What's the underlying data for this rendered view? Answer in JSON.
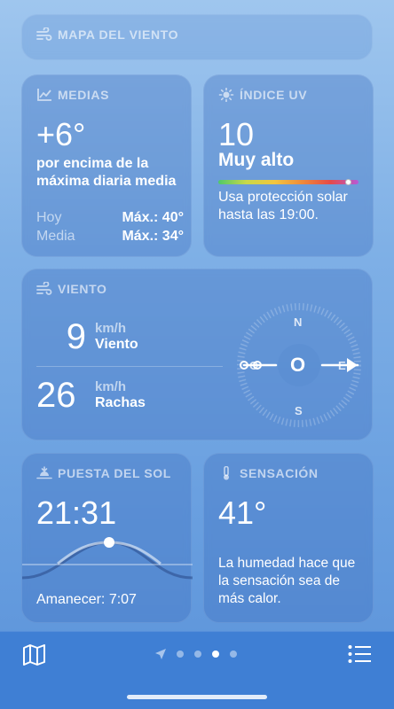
{
  "map_card": {
    "title": "MAPA DEL VIENTO",
    "icon": "wind-icon"
  },
  "medias": {
    "title": "MEDIAS",
    "icon": "chart-icon",
    "value": "+6°",
    "description": "por encima de la máxima diaria media",
    "rows": [
      {
        "label": "Hoy",
        "value": "Máx.: 40°"
      },
      {
        "label": "Media",
        "value": "Máx.: 34°"
      }
    ]
  },
  "uv": {
    "title": "ÍNDICE UV",
    "icon": "sun-icon",
    "value": "10",
    "level": "Muy alto",
    "level_fraction": 0.93,
    "advice": "Usa protección solar hasta las 19:00."
  },
  "wind": {
    "title": "VIENTO",
    "icon": "wind-icon",
    "speed_value": "9",
    "speed_unit": "km/h",
    "speed_label": "Viento",
    "gust_value": "26",
    "gust_unit": "km/h",
    "gust_label": "Rachas",
    "compass": {
      "n": "N",
      "e": "E",
      "s": "S",
      "w": "O",
      "center": "O"
    }
  },
  "sunset": {
    "title": "PUESTA DEL SOL",
    "icon": "sunset-icon",
    "time": "21:31",
    "sunrise": "Amanecer: 7:07"
  },
  "feels": {
    "title": "SENSACIÓN",
    "icon": "thermometer-icon",
    "value": "41°",
    "description": "La humedad hace que la sensación sea de más calor."
  },
  "bottom_bar": {
    "left_icon": "map-icon",
    "right_icon": "list-icon",
    "active_page": 3
  }
}
